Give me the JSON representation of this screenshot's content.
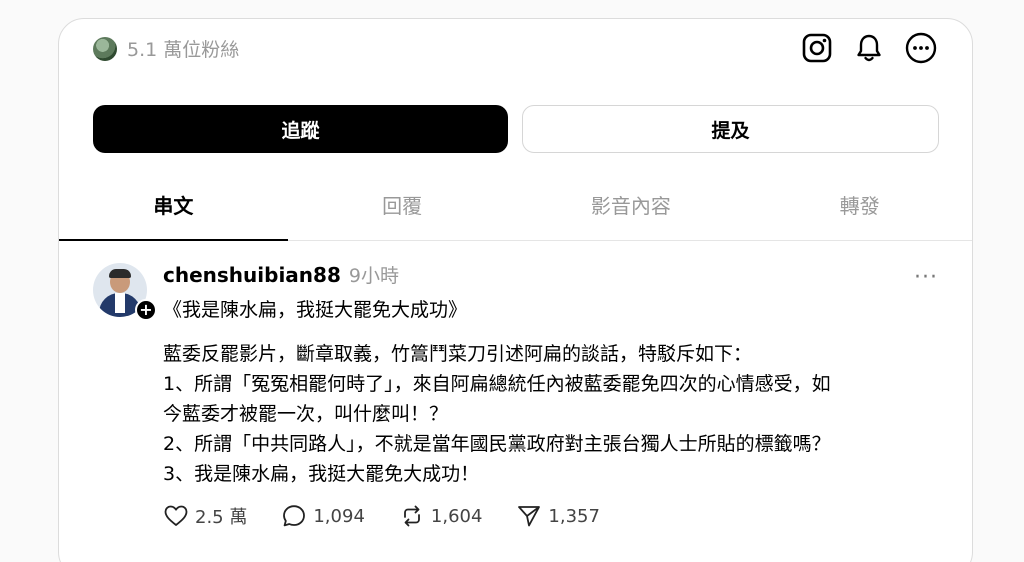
{
  "profile": {
    "followers": "5.1 萬位粉絲"
  },
  "icons": {
    "instagram": "instagram-icon",
    "notifications": "bell-icon",
    "more": "more-options-icon"
  },
  "buttons": {
    "follow": "追蹤",
    "mention": "提及"
  },
  "tabs": [
    {
      "label": "串文",
      "active": true
    },
    {
      "label": "回覆",
      "active": false
    },
    {
      "label": "影音內容",
      "active": false
    },
    {
      "label": "轉發",
      "active": false
    }
  ],
  "post": {
    "username": "chenshuibian88",
    "time": "9小時",
    "more": "···",
    "title": "《我是陳水扁，我挺大罷免大成功》",
    "lines": [
      "藍委反罷影片，斷章取義，竹篙鬥菜刀引述阿扁的談話，特駁斥如下：",
      "1、所謂「冤冤相罷何時了」，來自阿扁總統任內被藍委罷免四次的心情感受，如",
      "今藍委才被罷一次，叫什麼叫！？",
      "2、所謂「中共同路人」，不就是當年國民黨政府對主張台獨人士所貼的標籤嗎？",
      "3、我是陳水扁，我挺大罷免大成功！"
    ],
    "stats": {
      "likes": "2.5 萬",
      "replies": "1,094",
      "reposts": "1,604",
      "shares": "1,357"
    }
  }
}
